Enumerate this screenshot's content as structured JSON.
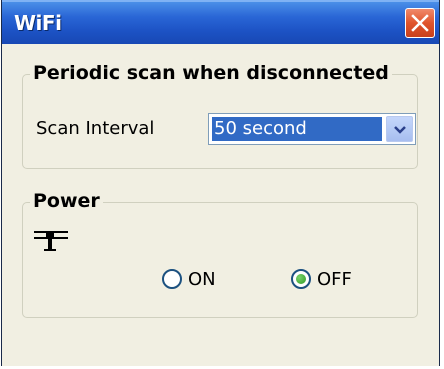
{
  "window": {
    "title": "WiFi",
    "close_icon": "close-icon"
  },
  "scan_group": {
    "title": "Periodic scan when disconnected",
    "interval_label": "Scan Interval",
    "interval_value": "50 second"
  },
  "power_group": {
    "title": "Power",
    "icon": "wifi-antenna-icon",
    "on_label": "ON",
    "off_label": "OFF",
    "selected": "OFF"
  },
  "colors": {
    "titlebar": "#2a66d6",
    "close_button": "#e0542c",
    "selection": "#316ac5",
    "radio_checked": "#2f9b26"
  }
}
